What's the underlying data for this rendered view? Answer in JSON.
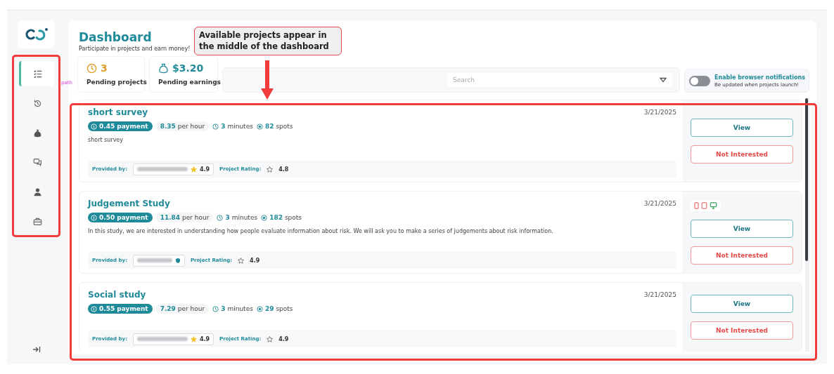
{
  "logo": {
    "kind": "logo"
  },
  "sidebar": {
    "items": [
      {
        "selected": true
      },
      {
        "selected": false
      },
      {
        "selected": false
      },
      {
        "selected": false
      },
      {
        "selected": false
      },
      {
        "selected": false
      }
    ]
  },
  "header": {
    "title": "Dashboard",
    "subtitle": "Participate in projects and earn money!"
  },
  "stats": [
    {
      "value": "3",
      "label": "Pending projects",
      "color": "#e0a030"
    },
    {
      "value": "$3.20",
      "label": "Pending earnings",
      "color": "#1f8a99"
    }
  ],
  "search": {
    "placeholder": "Search"
  },
  "notifications": {
    "on": false,
    "title": "Enable browser notifications",
    "subtitle": "Be updated when projects launch!"
  },
  "projects": [
    {
      "title": "short survey",
      "payment": "0.45 payment",
      "rate_value": "8.35",
      "rate_unit": "per hour",
      "minutes_value": "3",
      "minutes_unit": "minutes",
      "spots_value": "82",
      "spots_unit": "spots",
      "description": "short survey",
      "provided_label": "Provided by:",
      "provider": {
        "kind": "star",
        "rating": "4.9"
      },
      "rating_label": "Project Rating:",
      "rating": "4.8",
      "date": "3/21/2025",
      "view": "View",
      "dismiss": "Not Interested"
    },
    {
      "title": "Judgement Study",
      "payment": "0.50 payment",
      "rate_value": "11.84",
      "rate_unit": "per hour",
      "minutes_value": "3",
      "minutes_unit": "minutes",
      "spots_value": "182",
      "spots_unit": "spots",
      "description": "In this study, we are interested in understanding how people evaluate information about risk. We will ask you to make a series of judgements about risk information.",
      "provided_label": "Provided by:",
      "provider": {
        "kind": "shield"
      },
      "rating_label": "Project Rating:",
      "rating": "4.9",
      "date": "3/21/2025",
      "devices": [
        {
          "kind": "phone",
          "available": false
        },
        {
          "kind": "tablet",
          "available": false
        },
        {
          "kind": "desktop",
          "available": true
        }
      ],
      "view": "View",
      "dismiss": "Not Interested"
    },
    {
      "title": "Social study",
      "payment": "0.55 payment",
      "rate_value": "7.29",
      "rate_unit": "per hour",
      "minutes_value": "3",
      "minutes_unit": "minutes",
      "spots_value": "29",
      "spots_unit": "spots",
      "provided_label": "Provided by:",
      "provider": {
        "kind": "star",
        "rating": "4.9"
      },
      "rating_label": "Project Rating:",
      "rating": "4.9",
      "date": "3/21/2025",
      "view": "View",
      "dismiss": "Not Interested"
    }
  ],
  "annotation": {
    "callout": "Available projects appear in the middle of the dashboard",
    "stray_label": "path"
  }
}
